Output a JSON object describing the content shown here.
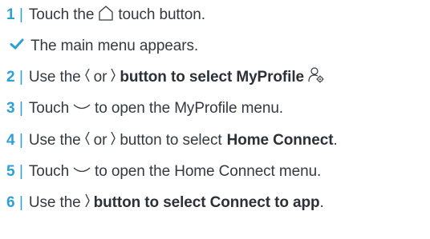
{
  "steps": [
    {
      "num": "1",
      "sep": "|",
      "text_a": "Touch the",
      "text_b": "touch button."
    },
    {
      "result": "The main menu appears."
    },
    {
      "num": "2",
      "sep": "|",
      "text_a": "Use the",
      "text_b": "or",
      "text_c": "button to select MyProfile"
    },
    {
      "num": "3",
      "sep": "|",
      "text_a": "Touch",
      "text_b": "to open the MyProfile menu."
    },
    {
      "num": "4",
      "sep": "|",
      "text_a": "Use the",
      "text_b": "or",
      "text_c": "button to select",
      "text_bold": "Home Connect",
      "text_end": "."
    },
    {
      "num": "5",
      "sep": "|",
      "text_a": "Touch",
      "text_b": "to open the Home Connect menu."
    },
    {
      "num": "6",
      "sep": "|",
      "text_a": "Use the",
      "text_bold": "button to select Connect to app",
      "text_end": "."
    }
  ],
  "colors": {
    "accent": "#2d9fd9",
    "text": "#333a40"
  },
  "icons": [
    "home-icon",
    "checkmark-icon",
    "chevron-left-icon",
    "chevron-right-icon",
    "myprofile-icon",
    "chevron-down-icon"
  ]
}
